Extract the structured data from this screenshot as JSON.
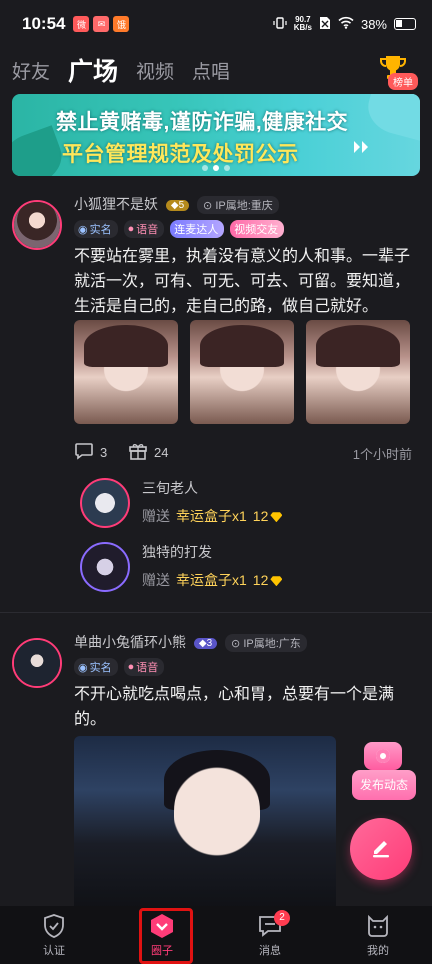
{
  "status_bar": {
    "time": "10:54",
    "app_icons": [
      {
        "name": "app-icon-1",
        "color": "#ff5a5a",
        "glyph": "微"
      },
      {
        "name": "app-icon-2",
        "color": "#ff6a6a",
        "glyph": "✉"
      },
      {
        "name": "app-icon-3",
        "color": "#ff7a2a",
        "glyph": "饿"
      }
    ],
    "net_speed_value": "90.7",
    "net_speed_unit": "KB/s",
    "battery": "38%"
  },
  "tabs": [
    "好友",
    "广场",
    "视频",
    "点唱"
  ],
  "active_tab": "广场",
  "rank_label": "榜单",
  "banner": {
    "line1": "禁止黄赌毒,谨防诈骗,健康社交",
    "line2": "平台管理规范及处罚公示"
  },
  "post1": {
    "username": "小狐狸不是妖",
    "level": "5",
    "ip": "IP属地:重庆",
    "badges": [
      "实名",
      "语音",
      "连麦达人",
      "视频交友"
    ],
    "text": "不要站在雾里，执着没有意义的人和事。一辈子就活一次，可有、可无、可去、可留。要知道，生活是自己的，走自己的路，做自己就好。",
    "comments": "3",
    "gifts": "24",
    "time": "1个小时前",
    "gift_list": [
      {
        "name": "三旬老人",
        "action": "赠送",
        "item": "幸运盒子x1",
        "count": "12"
      },
      {
        "name": "独特的打发",
        "action": "赠送",
        "item": "幸运盒子x1",
        "count": "12"
      }
    ]
  },
  "post2": {
    "username": "单曲小兔循环小熊",
    "level": "3",
    "ip": "IP属地:广东",
    "badges": [
      "实名",
      "语音"
    ],
    "text": "不开心就吃点喝点，心和胃，总要有一个是满的。"
  },
  "publish_label": "发布动态",
  "nav": [
    {
      "label": "认证",
      "icon": "shield-icon"
    },
    {
      "label": "圈子",
      "icon": "circle-icon"
    },
    {
      "label": "消息",
      "icon": "message-icon",
      "badge": "2"
    },
    {
      "label": "我的",
      "icon": "profile-icon"
    }
  ],
  "colors": {
    "accent": "#ff3c78",
    "background": "#1b1b1f",
    "gold": "#ffd35a"
  }
}
